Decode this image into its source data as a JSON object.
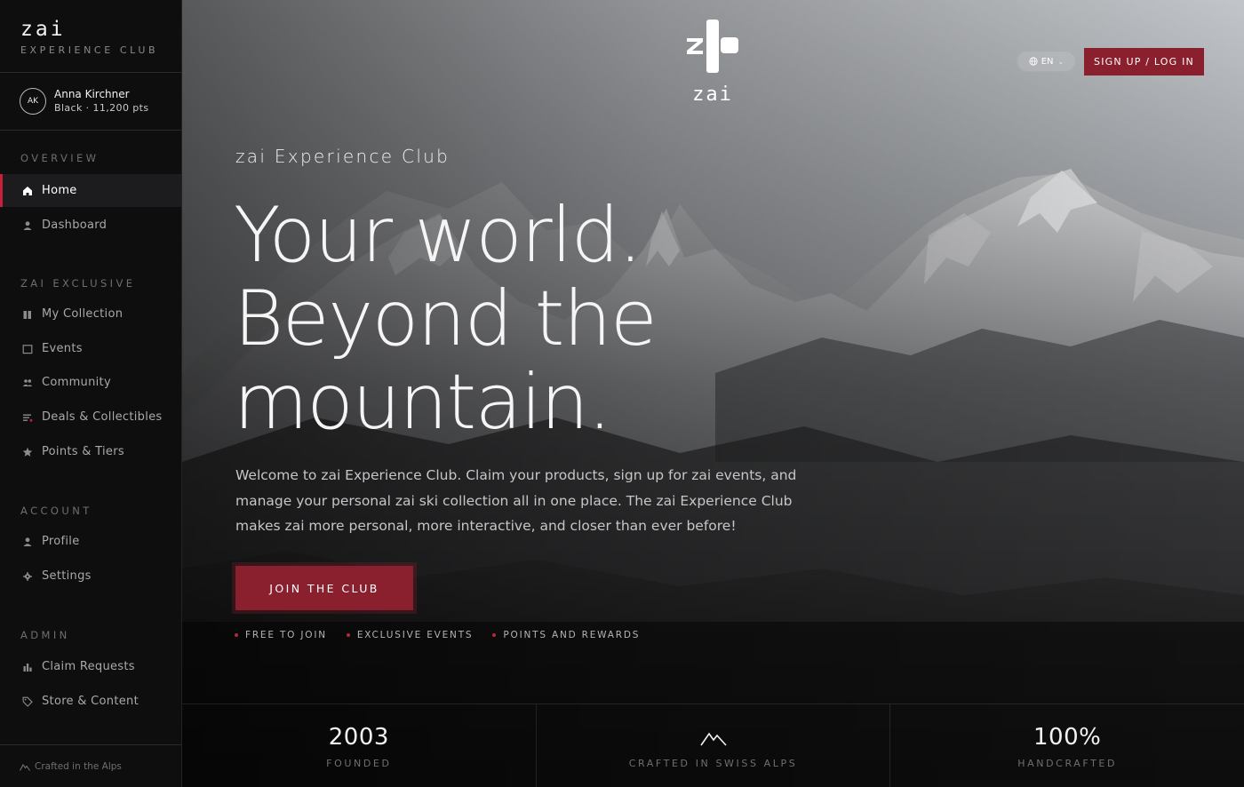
{
  "brand": {
    "wordmark": "zai",
    "subtitle": "EXPERIENCE CLUB"
  },
  "user": {
    "initials": "AK",
    "name": "Anna Kirchner",
    "meta": "Black · 11,200 pts"
  },
  "sidebar": {
    "sections": [
      {
        "label": "OVERVIEW",
        "items": [
          {
            "label": "Home",
            "icon": "home-icon",
            "active": true
          },
          {
            "label": "Dashboard",
            "icon": "person-icon"
          }
        ]
      },
      {
        "label": "ZAI EXCLUSIVE",
        "items": [
          {
            "label": "My Collection",
            "icon": "collection-icon"
          },
          {
            "label": "Events",
            "icon": "calendar-icon"
          },
          {
            "label": "Community",
            "icon": "community-icon"
          },
          {
            "label": "Deals & Collectibles",
            "icon": "deals-icon"
          },
          {
            "label": "Points & Tiers",
            "icon": "star-icon"
          }
        ]
      },
      {
        "label": "ACCOUNT",
        "items": [
          {
            "label": "Profile",
            "icon": "person-icon"
          },
          {
            "label": "Settings",
            "icon": "gear-icon"
          }
        ]
      },
      {
        "label": "ADMIN",
        "items": [
          {
            "label": "Claim Requests",
            "icon": "bar-chart-icon"
          },
          {
            "label": "Store & Content",
            "icon": "tag-icon"
          }
        ]
      }
    ],
    "footer": "Crafted in the Alps"
  },
  "header": {
    "logo_word": "zai",
    "language": "EN",
    "auth_label": "SIGN UP / LOG IN"
  },
  "hero": {
    "eyebrow": "zai Experience Club",
    "headline": [
      "Your world.",
      "Beyond the",
      "mountain."
    ],
    "intro": "Welcome to zai Experience Club. Claim your products, sign up for zai events, and manage your personal zai ski collection all in one place. The zai Experience Club makes zai more personal, more interactive, and closer than ever before!",
    "cta": "JOIN THE CLUB",
    "perks": [
      "FREE TO JOIN",
      "EXCLUSIVE EVENTS",
      "POINTS AND REWARDS"
    ]
  },
  "stats": [
    {
      "value": "2003",
      "label": "FOUNDED"
    },
    {
      "icon": "mountain-icon",
      "label": "CRAFTED IN SWISS ALPS"
    },
    {
      "value": "100%",
      "label": "HANDCRAFTED"
    }
  ],
  "colors": {
    "accent": "#8a1f2e",
    "active_marker": "#c8203a",
    "sidebar_bg": "#0e0e0f"
  }
}
